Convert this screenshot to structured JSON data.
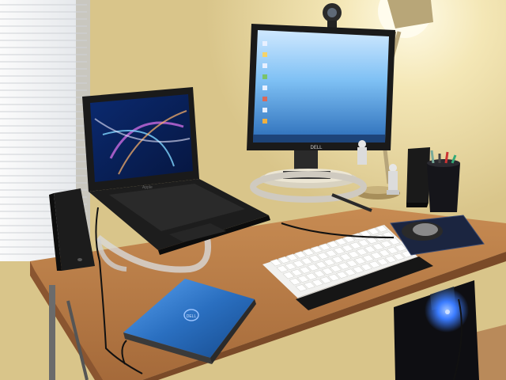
{
  "scene": {
    "laptop_brand": "Apple",
    "monitor_brand": "DELL",
    "netbook_brand": "DELL"
  },
  "colors": {
    "wall": "#e6d49a",
    "wall_warm": "#f3e6b4",
    "desk_top": "#b57a45",
    "desk_edge": "#8a5530",
    "netbook_blue": "#2a6fc0",
    "monitor_screen": "#5aa8e8",
    "laptop_screen": "#0d2a6a",
    "tower_led": "#3a7bff"
  }
}
